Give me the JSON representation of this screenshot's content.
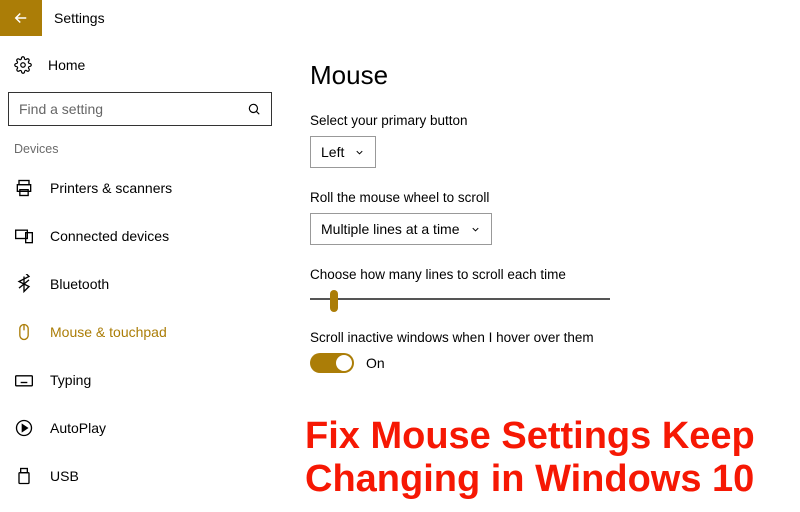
{
  "app_title": "Settings",
  "home_label": "Home",
  "search_placeholder": "Find a setting",
  "group_label": "Devices",
  "nav": [
    {
      "id": "printers",
      "label": "Printers & scanners"
    },
    {
      "id": "connected",
      "label": "Connected devices"
    },
    {
      "id": "bluetooth",
      "label": "Bluetooth"
    },
    {
      "id": "mouse",
      "label": "Mouse & touchpad"
    },
    {
      "id": "typing",
      "label": "Typing"
    },
    {
      "id": "autoplay",
      "label": "AutoPlay"
    },
    {
      "id": "usb",
      "label": "USB"
    }
  ],
  "page_title": "Mouse",
  "primary_button": {
    "label": "Select your primary button",
    "value": "Left"
  },
  "wheel_scroll": {
    "label": "Roll the mouse wheel to scroll",
    "value": "Multiple lines at a time"
  },
  "lines": {
    "label": "Choose how many lines to scroll each time"
  },
  "inactive": {
    "label": "Scroll inactive windows when I hover over them",
    "state": "On"
  },
  "overlay_text": "Fix Mouse Settings Keep Changing in Windows 10",
  "colors": {
    "accent": "#ab7d07",
    "overlay": "#f61804"
  }
}
